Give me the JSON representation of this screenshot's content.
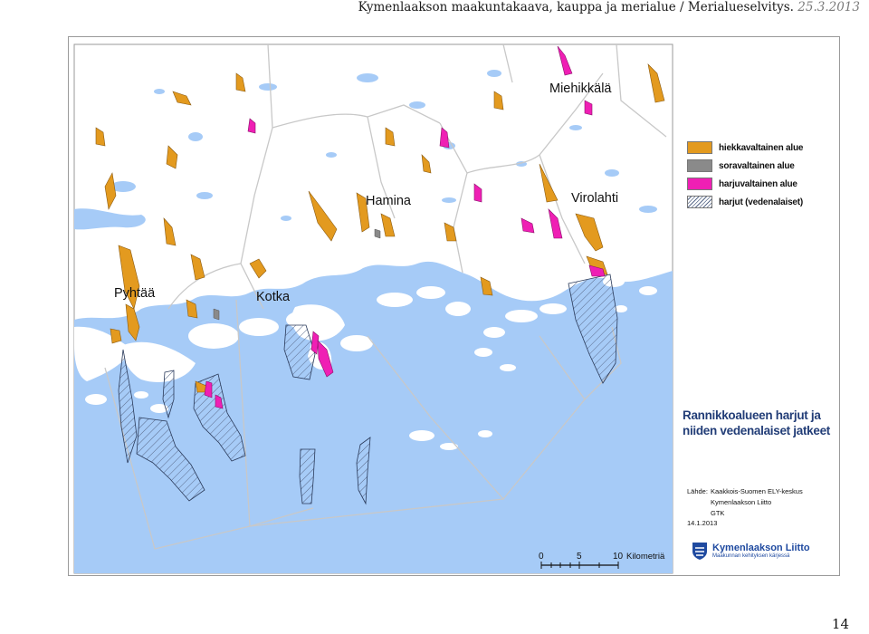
{
  "header": {
    "title": "Kymenlaakson maakuntakaava, kauppa ja merialue / Merialueselvitys.",
    "date": "25.3.2013"
  },
  "page_number": "14",
  "map": {
    "places": [
      "Miehikkälä",
      "Hamina",
      "Virolahti",
      "Pyhtää",
      "Kotka"
    ],
    "colors": {
      "sea": "#a6cbf7",
      "land": "#ffffff",
      "hiekka": "#e39a1f",
      "sora": "#8a8a8a",
      "harju": "#ef1fb4",
      "hatch": "#5a6a8a"
    },
    "legend": [
      {
        "label": "hiekkavaltainen alue",
        "type": "hiekka"
      },
      {
        "label": "soravaltainen alue",
        "type": "sora"
      },
      {
        "label": "harjuvaltainen alue",
        "type": "harju"
      },
      {
        "label": "harjut (vedenalaiset)",
        "type": "hatch"
      }
    ],
    "title": "Rannikkoalueen harjut ja niiden vedenalaiset jatkeet",
    "source_label": "Lähde:",
    "sources": [
      "Kaakkois-Suomen ELY-keskus",
      "Kymenlaakson Liitto",
      "GTK"
    ],
    "date": "14.1.2013",
    "scale": {
      "ticks": [
        "0",
        "5",
        "10"
      ],
      "unit": "Kilometriä"
    },
    "logo": {
      "name": "Kymenlaakson Liitto",
      "subtitle": "Maakunnan kehityksen kärjessä"
    }
  }
}
